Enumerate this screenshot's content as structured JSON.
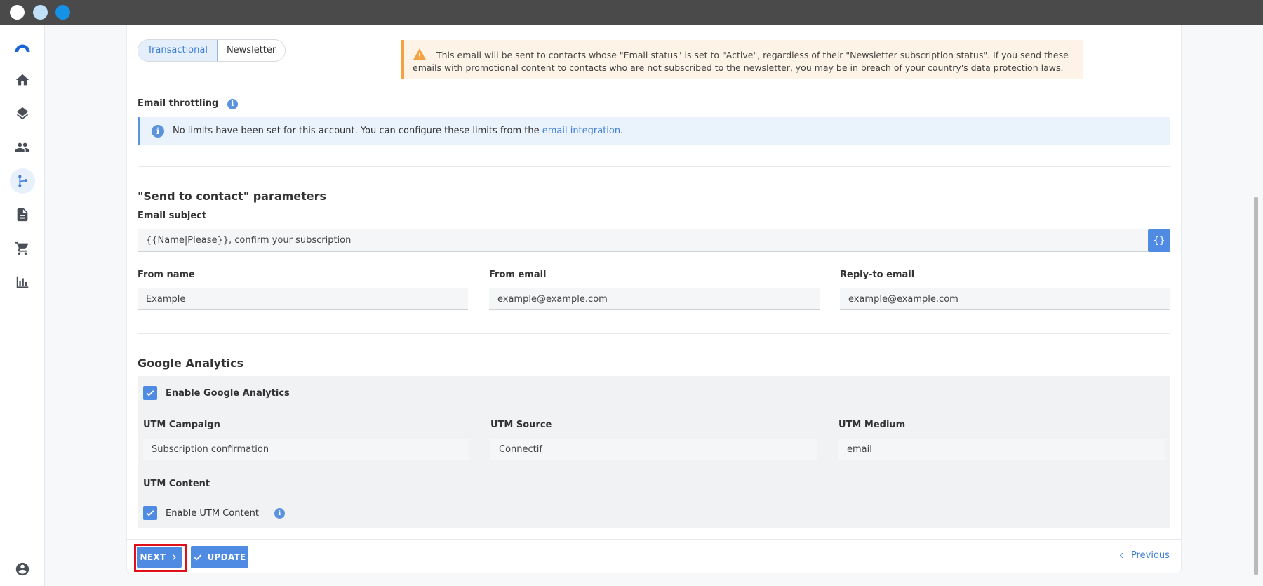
{
  "window": {
    "controls": [
      "close",
      "minimize",
      "maximize"
    ]
  },
  "sidebar": {
    "icons": [
      "logo-icon",
      "home-icon",
      "layers-icon",
      "people-icon",
      "workflow-icon",
      "document-icon",
      "cart-icon",
      "bar-chart-icon",
      "account-icon"
    ],
    "active": "workflow-icon"
  },
  "email_type": {
    "options": [
      "Transactional",
      "Newsletter"
    ],
    "selected": "Transactional"
  },
  "warning": {
    "text": "This email will be sent to contacts whose \"Email status\" is set to \"Active\", regardless of their \"Newsletter subscription status\". If you send these emails with promotional content to contacts who are not subscribed to the newsletter, you may be in breach of your country's data protection laws."
  },
  "throttling": {
    "label": "Email throttling",
    "message_before": "No limits have been set for this account. You can configure these limits from the",
    "link": "email integration",
    "message_after": "."
  },
  "send_params": {
    "title": "\"Send to contact\" parameters",
    "subject_label": "Email subject",
    "subject_value": "{{Name|Please}}, confirm your subscription",
    "from_name_label": "From name",
    "from_name_value": "Example",
    "from_email_label": "From email",
    "from_email_value": "example@example.com",
    "reply_to_label": "Reply-to email",
    "reply_to_value": "example@example.com"
  },
  "google_analytics": {
    "title": "Google Analytics",
    "enable_label": "Enable Google Analytics",
    "enable_checked": true,
    "utm_campaign_label": "UTM Campaign",
    "utm_campaign_value": "Subscription confirmation",
    "utm_source_label": "UTM Source",
    "utm_source_value": "Connectif",
    "utm_medium_label": "UTM Medium",
    "utm_medium_value": "email",
    "utm_content_label": "UTM Content",
    "enable_utm_content_label": "Enable UTM Content",
    "utm_content_checked": true
  },
  "footer": {
    "next_label": "NEXT",
    "update_label": "UPDATE",
    "previous_label": "Previous"
  },
  "colors": {
    "accent": "#4f8be3",
    "warning": "#f4a142",
    "highlight": "#e0101a"
  }
}
